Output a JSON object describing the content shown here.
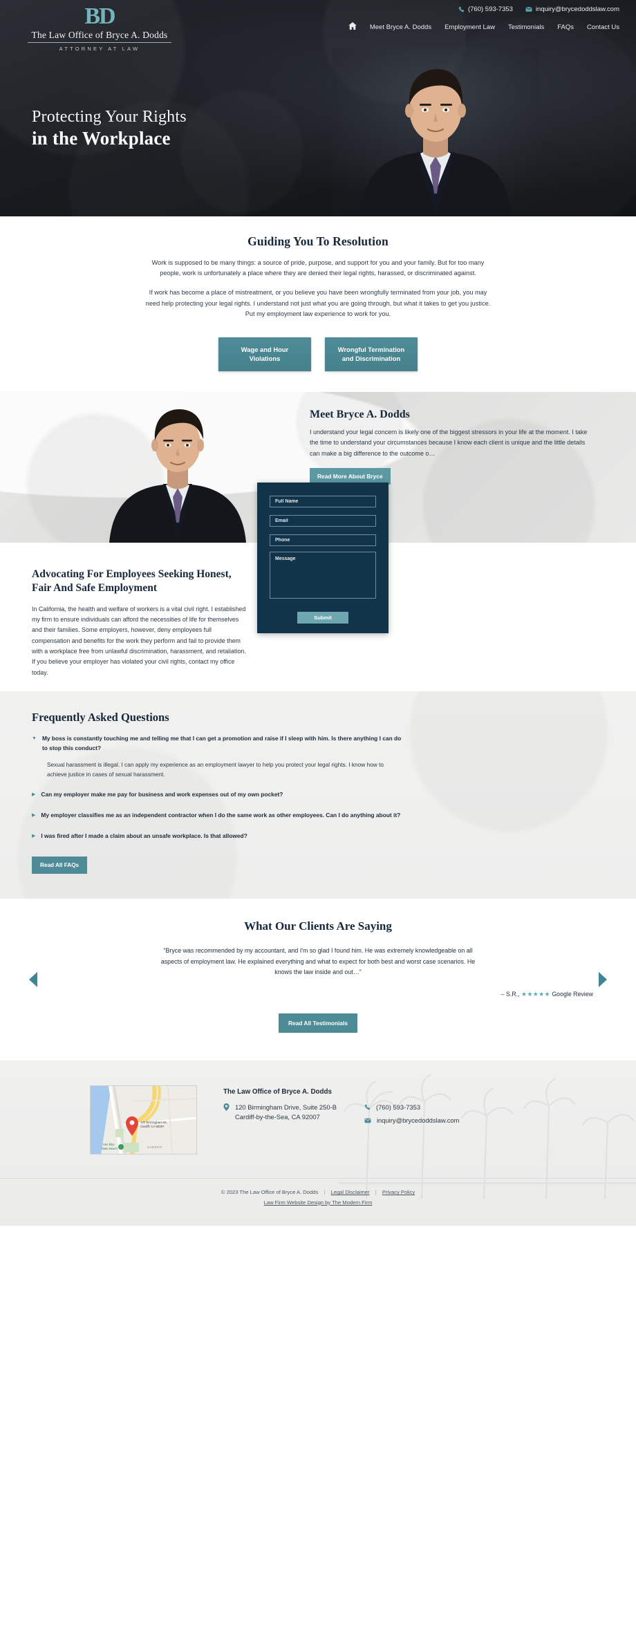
{
  "brand": {
    "monogram": "BD",
    "name": "The Law Office of Bryce A. Dodds",
    "tagline": "ATTORNEY AT LAW"
  },
  "topbar": {
    "phone": "(760) 593-7353",
    "email": "inquiry@brycedoddslaw.com"
  },
  "nav": {
    "home_label": "Home",
    "items": [
      {
        "label": "Meet Bryce A. Dodds"
      },
      {
        "label": "Employment Law"
      },
      {
        "label": "Testimonials"
      },
      {
        "label": "FAQs"
      },
      {
        "label": "Contact Us"
      }
    ]
  },
  "hero": {
    "line1": "Protecting Your Rights",
    "line2": "in the Workplace"
  },
  "intro": {
    "title": "Guiding You To Resolution",
    "paragraph1": "Work is supposed to be many things: a source of pride, purpose, and support for you and your family. But for too many people, work is unfortunately a place where they are denied their legal rights, harassed, or discriminated against.",
    "paragraph2": "If work has become a place of mistreatment, or you believe you have been wrongfully terminated from your job, you may need help protecting your legal rights. I understand not just what you are going through, but what it takes to get you justice. Put my employment law experience to work for you.",
    "cta": [
      {
        "line1": "Wage and Hour",
        "line2": "Violations"
      },
      {
        "line1": "Wrongful Termination",
        "line2": "and Discrimination"
      }
    ]
  },
  "meet": {
    "title": "Meet Bryce A. Dodds",
    "body": "I understand your legal concern is likely one of the biggest stressors in your life at the moment. I take the time to understand your circumstances because I know each client is unique and the little details can make a big difference to the outcome o…",
    "button": "Read More About Bryce"
  },
  "advocating": {
    "title": "Advocating For Employees Seeking Honest, Fair And Safe Employment",
    "body": "In California, the health and welfare of workers is a vital civil right. I established my firm to ensure individuals can afford the necessities of life for themselves and their families. Some employers, however, deny employees full compensation and benefits for the work they perform and fail to provide them with a workplace free from unlawful discrimination, harassment, and retaliation. If you believe your employer has violated your civil rights, contact my office today."
  },
  "form": {
    "fields": [
      {
        "name": "full_name",
        "placeholder": "Full Name",
        "value": ""
      },
      {
        "name": "email",
        "placeholder": "Email",
        "value": ""
      },
      {
        "name": "phone",
        "placeholder": "Phone",
        "value": ""
      }
    ],
    "message_placeholder": "Message",
    "message_value": "",
    "submit_label": "Submit"
  },
  "faq": {
    "title": "Frequently Asked Questions",
    "items": [
      {
        "question": "My boss is constantly touching me and telling me that I can get a promotion and raise if I sleep with him. Is there anything I can do to stop this conduct?",
        "answer": "Sexual harassment is illegal. I can apply my experience as an employment lawyer to help you protect your legal rights. I know how to achieve justice in cases of sexual harassment.",
        "expanded": true
      },
      {
        "question": "Can my employer make me pay for business and work expenses out of my own pocket?",
        "answer": "",
        "expanded": false
      },
      {
        "question": "My employer classifies me as an independent contractor when I do the same work as other employees. Can I do anything about it?",
        "answer": "",
        "expanded": false
      },
      {
        "question": "I was fired after I made a claim about an unsafe workplace. Is that allowed?",
        "answer": "",
        "expanded": false
      }
    ],
    "button": "Read All FAQs"
  },
  "testimonials": {
    "title": "What Our Clients Are Saying",
    "quote": "\"Bryce was recommended by my accountant, and I'm so glad I found him. He was extremely knowledgeable on all aspects of employment law. He explained everything and what to expect for both best and worst case scenarios. He knows the law inside and out…\"",
    "author": "– S.R.,",
    "stars": "★★★★★",
    "source": "Google Review",
    "button": "Read All Testimonials"
  },
  "footer": {
    "firm_name": "The Law Office of Bryce A. Dodds",
    "address_line1": "120 Birmingham Drive, Suite 250-B",
    "address_line2": "Cardiff-by-the-Sea, CA 92007",
    "phone": "(760) 593-7353",
    "email": "inquiry@brycedoddslaw.com",
    "map_pin_line1": "120 Birmingham Dr,",
    "map_pin_line2": "Cardiff, CA 92007",
    "map_label_beach": "San Elijo State Beach",
    "map_label_town": "CARDIFF",
    "copyright": "© 2023 The Law Office of Bryce A. Dodds",
    "legal_disclaimer": "Legal Disclaimer",
    "privacy_policy": "Privacy Policy",
    "credit": "Law Firm Website Design by The Modern Firm"
  },
  "colors": {
    "teal": "#4d8c97",
    "teal_light": "#6fa7b1",
    "navy": "#12344a",
    "dark": "#16283a"
  }
}
